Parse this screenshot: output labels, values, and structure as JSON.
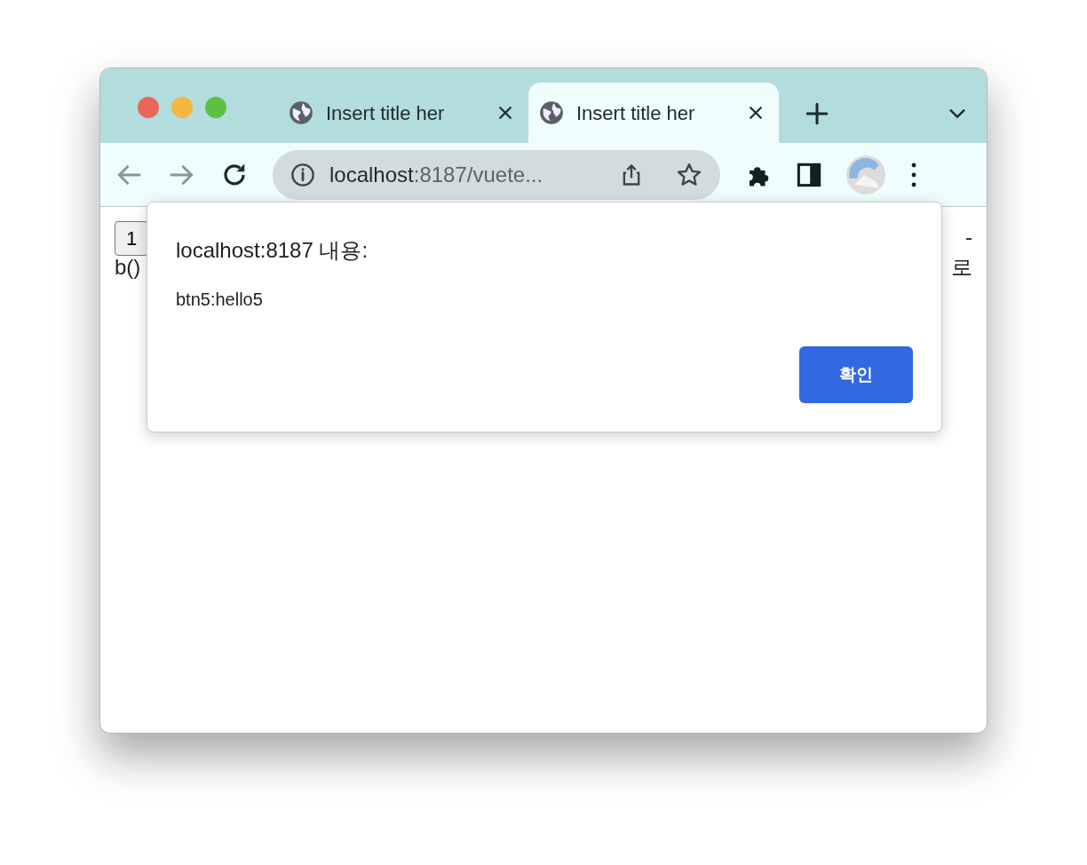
{
  "tabs": [
    {
      "title": "Insert title her",
      "selected": false
    },
    {
      "title": "Insert title her",
      "selected": true
    }
  ],
  "address_bar": {
    "host": "localhost",
    "rest": ":8187/vuete..."
  },
  "page": {
    "button": "1",
    "line_1_end": "-",
    "line_2_start": "b()",
    "line_2_end": "로"
  },
  "dialog": {
    "title": "localhost:8187 내용:",
    "message": "btn5:hello5",
    "ok_button": "확인"
  }
}
